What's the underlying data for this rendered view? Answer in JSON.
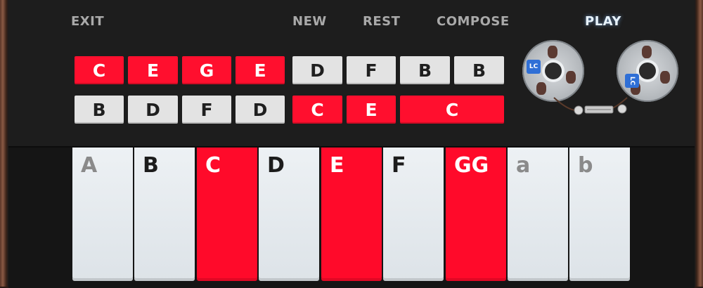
{
  "nav": {
    "exit": "EXIT",
    "new": "NEW",
    "rest": "REST",
    "compose": "COMPOSE",
    "play": "PLAY"
  },
  "sequence": {
    "row1": [
      {
        "note": "C",
        "state": "active"
      },
      {
        "note": "E",
        "state": "active"
      },
      {
        "note": "G",
        "state": "active"
      },
      {
        "note": "E",
        "state": "active"
      },
      {
        "note": "D",
        "state": "inactive"
      },
      {
        "note": "F",
        "state": "inactive"
      },
      {
        "note": "B",
        "state": "inactive"
      },
      {
        "note": "B",
        "state": "inactive"
      }
    ],
    "row2": [
      {
        "note": "B",
        "state": "inactive"
      },
      {
        "note": "D",
        "state": "inactive"
      },
      {
        "note": "F",
        "state": "inactive"
      },
      {
        "note": "D",
        "state": "inactive"
      },
      {
        "note": "C",
        "state": "active"
      },
      {
        "note": "E",
        "state": "active"
      },
      {
        "note": "C",
        "state": "active"
      }
    ]
  },
  "tape": {
    "left_badge": "LC",
    "right_badge": "LC"
  },
  "keys": [
    {
      "label": "A",
      "state": "inactive",
      "label_tone": "gray"
    },
    {
      "label": "B",
      "state": "inactive",
      "label_tone": "dark"
    },
    {
      "label": "C",
      "state": "active",
      "label_tone": "white"
    },
    {
      "label": "D",
      "state": "inactive",
      "label_tone": "dark"
    },
    {
      "label": "E",
      "state": "active",
      "label_tone": "white"
    },
    {
      "label": "F",
      "state": "inactive",
      "label_tone": "dark"
    },
    {
      "label": "GG",
      "state": "active",
      "label_tone": "white"
    },
    {
      "label": "a",
      "state": "inactive",
      "label_tone": "gray"
    },
    {
      "label": "b",
      "state": "inactive",
      "label_tone": "gray"
    }
  ],
  "colors": {
    "active": "#ff0f2e",
    "inactive": "#e3e3e3",
    "panel": "#1d1d1d",
    "wood": "#8a5a44"
  }
}
